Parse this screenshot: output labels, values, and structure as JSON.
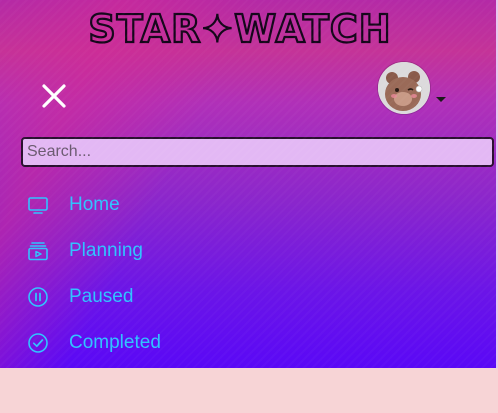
{
  "header": {
    "logo_text": "STAR✦WATCH"
  },
  "search": {
    "placeholder": "Search..."
  },
  "nav": {
    "items": [
      {
        "label": "Home",
        "icon": "tv-icon"
      },
      {
        "label": "Planning",
        "icon": "playlist-play-icon"
      },
      {
        "label": "Paused",
        "icon": "pause-circle-icon"
      },
      {
        "label": "Completed",
        "icon": "check-circle-icon"
      }
    ]
  },
  "colors": {
    "accent": "#2fc3ff",
    "panel_top": "#b42aa6",
    "panel_bottom": "#5a08f6",
    "page_background": "#f7d4d6",
    "search_background": "#e3b8f4"
  }
}
